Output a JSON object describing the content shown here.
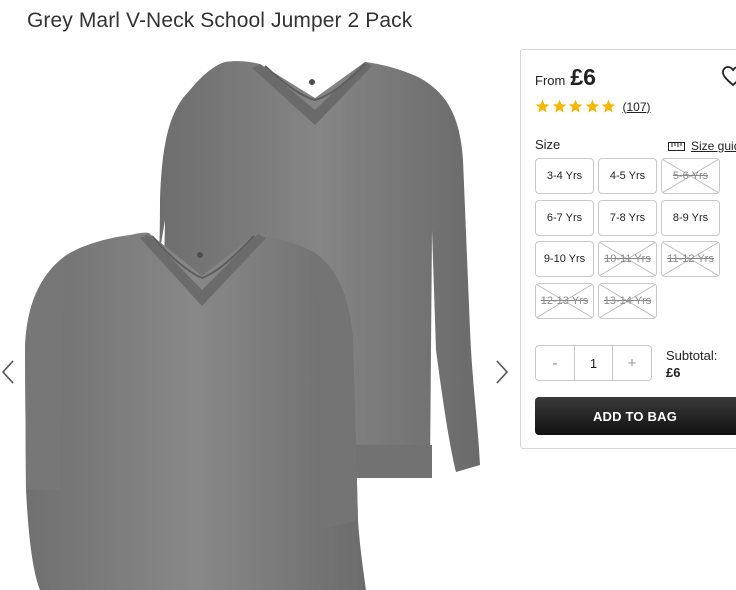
{
  "product": {
    "title": "Grey Marl V-Neck School Jumper 2 Pack"
  },
  "gallery": {
    "prev_icon": "chevron-left-icon",
    "next_icon": "chevron-right-icon"
  },
  "purchase": {
    "from_label": "From",
    "price": "£6",
    "favourite_icon": "heart-icon",
    "rating": 5,
    "reviews_label": "(107)",
    "size_label": "Size",
    "size_guide_label": "Size guide",
    "sizes": [
      {
        "label": "3-4 Yrs",
        "available": true
      },
      {
        "label": "4-5 Yrs",
        "available": true
      },
      {
        "label": "5-6 Yrs",
        "available": false
      },
      {
        "label": "6-7 Yrs",
        "available": true
      },
      {
        "label": "7-8 Yrs",
        "available": true
      },
      {
        "label": "8-9 Yrs",
        "available": true
      },
      {
        "label": "9-10 Yrs",
        "available": true
      },
      {
        "label": "10-11 Yrs",
        "available": false
      },
      {
        "label": "11-12 Yrs",
        "available": false
      },
      {
        "label": "12-13 Yrs",
        "available": false
      },
      {
        "label": "13-14 Yrs",
        "available": false
      }
    ],
    "qty_minus": "-",
    "qty_value": "1",
    "qty_plus": "+",
    "subtotal_label": "Subtotal:",
    "subtotal_value": "£6",
    "add_to_bag_label": "ADD TO BAG"
  },
  "colors": {
    "star": "#f5b800",
    "button_dark": "#1a1a1a",
    "jumper_grey": "#7b7b7b"
  }
}
